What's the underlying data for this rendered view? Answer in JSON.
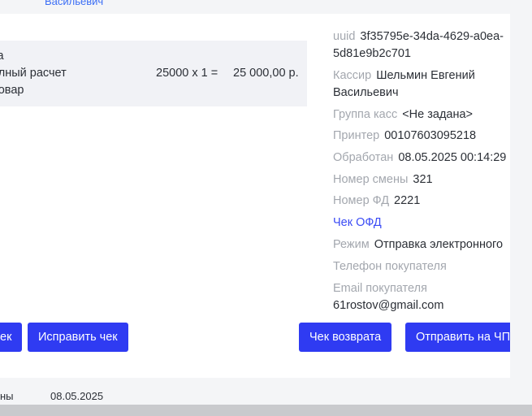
{
  "header": {
    "user_name_fragment": "Васильевич"
  },
  "receipt_items": {
    "line1": "та",
    "line2": "олный расчет",
    "line3": "Товар",
    "quantity_expr": "25000 x 1 =",
    "total": "25 000,00 р."
  },
  "info": {
    "uuid_label": "uuid",
    "uuid_line1": "3f35795e-34da-4629-a0ea-",
    "uuid_line2": "5d81e9b2c701",
    "cashier_label": "Кассир",
    "cashier_line1": "Шельмин Евгений",
    "cashier_line2": "Васильевич",
    "group_label": "Группа касс",
    "group_value": "<Не задана>",
    "printer_label": "Принтер",
    "printer_value": "00107603095218",
    "processed_label": "Обработан",
    "processed_value": "08.05.2025 00:14:29",
    "shift_label": "Номер смены",
    "shift_value": "321",
    "fd_label": "Номер ФД",
    "fd_value": "2221",
    "ofd_link": "Чек ОФД",
    "mode_label": "Режим",
    "mode_value": "Отправка электронного",
    "phone_label": "Телефон покупателя",
    "email_label": "Email покупателя",
    "email_value": "61rostov@gmail.com"
  },
  "actions": {
    "btn_partial": "ек",
    "btn_fix": "Исправить чек",
    "btn_return": "Чек возврата",
    "btn_send": "Отправить на ЧП"
  },
  "footer": {
    "left_text": "ны",
    "date": "08.05.2025"
  }
}
